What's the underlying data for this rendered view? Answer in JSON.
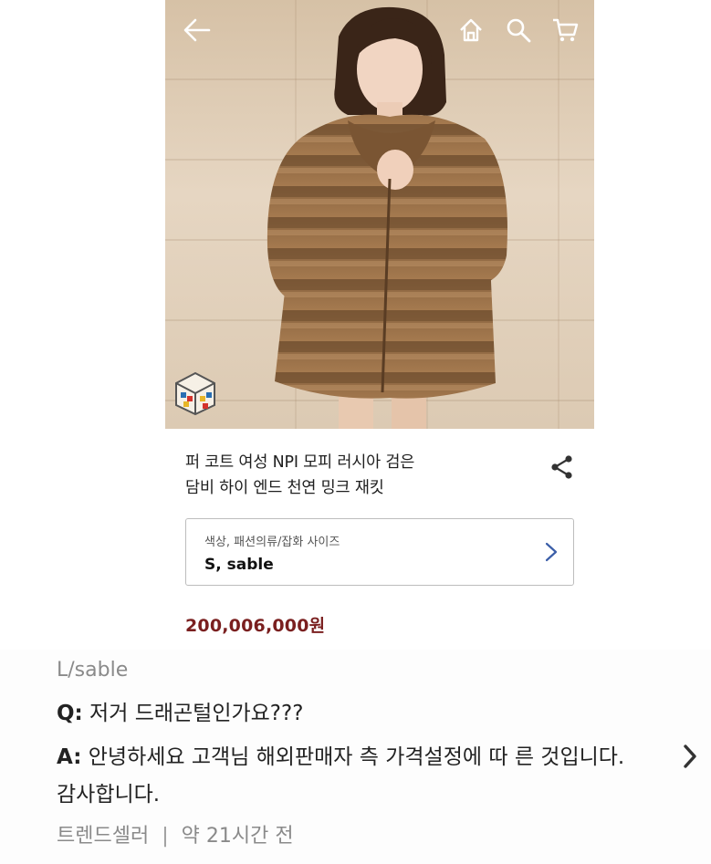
{
  "product": {
    "title_line1": "퍼 코트 여성 NPI 모피 러시아 검은",
    "title_line2": "담비 하이 엔드 천연 밍크 재킷",
    "option_label": "색상, 패션의류/잡화 사이즈",
    "option_value": "S, sable",
    "price": "200,006,000원"
  },
  "icons": {
    "back": "back-arrow-icon",
    "home": "home-icon",
    "search": "search-icon",
    "cart": "cart-icon",
    "share": "share-icon",
    "chevron": "chevron-right-icon"
  },
  "qa": {
    "variant": "L/sable",
    "question_prefix": "Q:",
    "question_text": " 저거 드래곤털인가요???",
    "answer_prefix": "A:",
    "answer_text": " 안녕하세요 고객님 해외판매자 측 가격설정에 따 른 것입니다. 감사합니다.",
    "seller": "트렌드셀러",
    "separator": "|",
    "time": "약 21시간 전"
  },
  "colors": {
    "price": "#7a1f1f",
    "muted": "#8a8a8a",
    "chevron": "#3b5ea8"
  }
}
